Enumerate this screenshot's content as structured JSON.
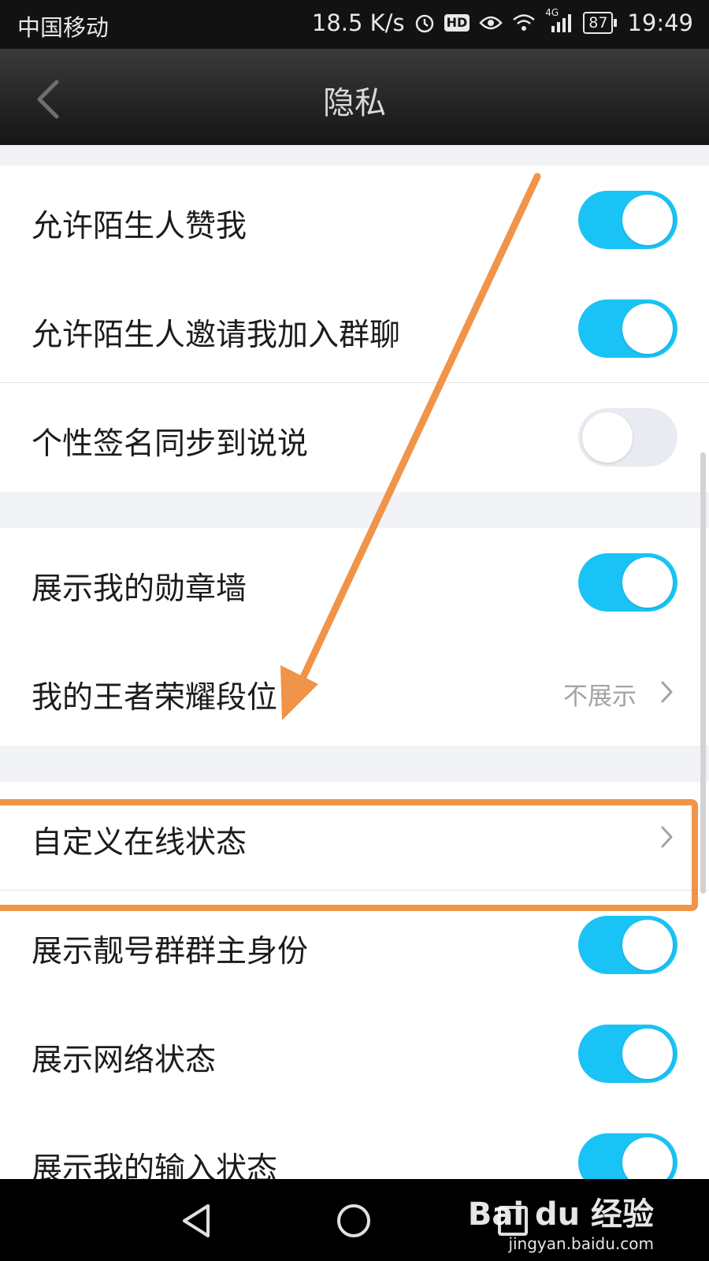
{
  "status_bar": {
    "carrier": "中国移动",
    "speed": "18.5 K/s",
    "hd": "HD",
    "network": "4G",
    "battery": "87",
    "time": "19:49"
  },
  "header": {
    "title": "隐私",
    "back_icon": "chevron-left-icon"
  },
  "settings": [
    {
      "label": "允许陌生人赞我",
      "toggle": true
    },
    {
      "label": "允许陌生人邀请我加入群聊",
      "toggle": true
    },
    {
      "label": "个性签名同步到说说",
      "toggle": false
    },
    {
      "label": "展示我的勋章墙",
      "toggle": true
    },
    {
      "label": "我的王者荣耀段位",
      "value": "不展示"
    },
    {
      "label": "自定义在线状态"
    },
    {
      "label": "展示靓号群群主身份",
      "toggle": true
    },
    {
      "label": "展示网络状态",
      "toggle": true
    },
    {
      "label": "展示我的输入状态",
      "toggle": true
    }
  ],
  "annotation": {
    "color": "#f0944a",
    "highlighted_item": "我的王者荣耀段位"
  },
  "watermark": {
    "brand": "Bai du 经验",
    "url": "jingyan.baidu.com"
  },
  "colors": {
    "toggle_on": "#1ac3f6",
    "toggle_off": "#e9ebf2"
  }
}
